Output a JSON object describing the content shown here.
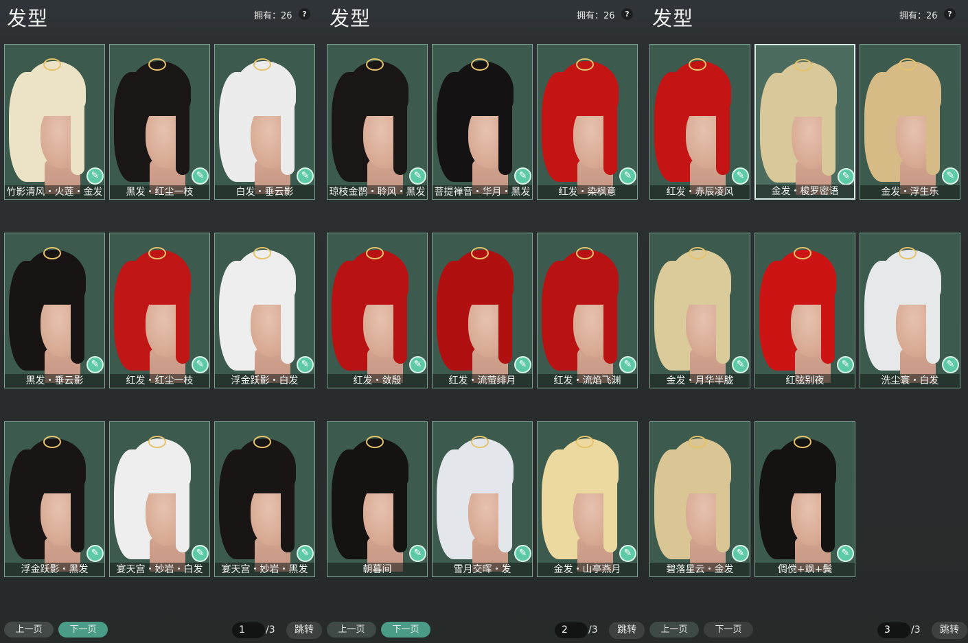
{
  "panels": [
    {
      "title": "发型",
      "owned_label": "拥有：26",
      "help_label": "?",
      "items": [
        {
          "name": "竹影清风・火莲・金发",
          "hair": "#ece3c6",
          "selected": false
        },
        {
          "name": "黑发・红尘一枝",
          "hair": "#1b1616",
          "selected": false
        },
        {
          "name": "白发・垂云影",
          "hair": "#ececec",
          "selected": false
        },
        {
          "name": "黑发・垂云影",
          "hair": "#181414",
          "selected": false
        },
        {
          "name": "红发・红尘一枝",
          "hair": "#c01616",
          "selected": false
        },
        {
          "name": "浮金跃影・白发",
          "hair": "#eeeeee",
          "selected": false
        },
        {
          "name": "浮金跃影・黑发",
          "hair": "#191515",
          "selected": false
        },
        {
          "name": "宴天宫・妙岩・白发",
          "hair": "#eeeeee",
          "selected": false
        },
        {
          "name": "宴天宫・妙岩・黑发",
          "hair": "#191515",
          "selected": false
        }
      ],
      "pager": {
        "prev": "上一页",
        "next": "下一页",
        "page": "1",
        "total": "/3",
        "jump": "跳转"
      }
    },
    {
      "title": "发型",
      "owned_label": "拥有：26",
      "help_label": "?",
      "items": [
        {
          "name": "琼枝金鹊・聆风・黑发",
          "hair": "#1a1616",
          "selected": false
        },
        {
          "name": "菩提禅音・华月・黑发",
          "hair": "#141212",
          "selected": false
        },
        {
          "name": "红发・染枫意",
          "hair": "#c41414",
          "selected": false
        },
        {
          "name": "红发・敛殷",
          "hair": "#b81212",
          "selected": false
        },
        {
          "name": "红发・流萤绯月",
          "hair": "#b01010",
          "selected": false
        },
        {
          "name": "红发・流焰飞渊",
          "hair": "#b81212",
          "selected": false
        },
        {
          "name": "朝暮间",
          "hair": "#151212",
          "selected": false
        },
        {
          "name": "雪月交晖・发",
          "hair": "#e3e6ea",
          "selected": false
        },
        {
          "name": "金发・山亭燕月",
          "hair": "#ecd9a0",
          "selected": false
        }
      ],
      "pager": {
        "prev": "上一页",
        "next": "下一页",
        "page": "2",
        "total": "/3",
        "jump": "跳转"
      }
    },
    {
      "title": "发型",
      "owned_label": "拥有：26",
      "help_label": "?",
      "items": [
        {
          "name": "红发・赤辰凌风",
          "hair": "#c41414",
          "selected": false
        },
        {
          "name": "金发・梭罗密语",
          "hair": "#d9c89a",
          "selected": true
        },
        {
          "name": "金发・浮生乐",
          "hair": "#d6bb86",
          "selected": false
        },
        {
          "name": "金发・月华半胧",
          "hair": "#dccb9a",
          "selected": false
        },
        {
          "name": "红弦别夜",
          "hair": "#cc1414",
          "selected": false
        },
        {
          "name": "洗尘寰・白发",
          "hair": "#e6e8ea",
          "selected": false
        },
        {
          "name": "碧落星云・金发",
          "hair": "#dac694",
          "selected": false
        },
        {
          "name": "倜傥+飒+鬓",
          "hair": "#151212",
          "selected": false
        }
      ],
      "pager": {
        "prev": "上一页",
        "next": "下一页",
        "page": "3",
        "total": "/3",
        "jump": "跳转"
      }
    }
  ]
}
